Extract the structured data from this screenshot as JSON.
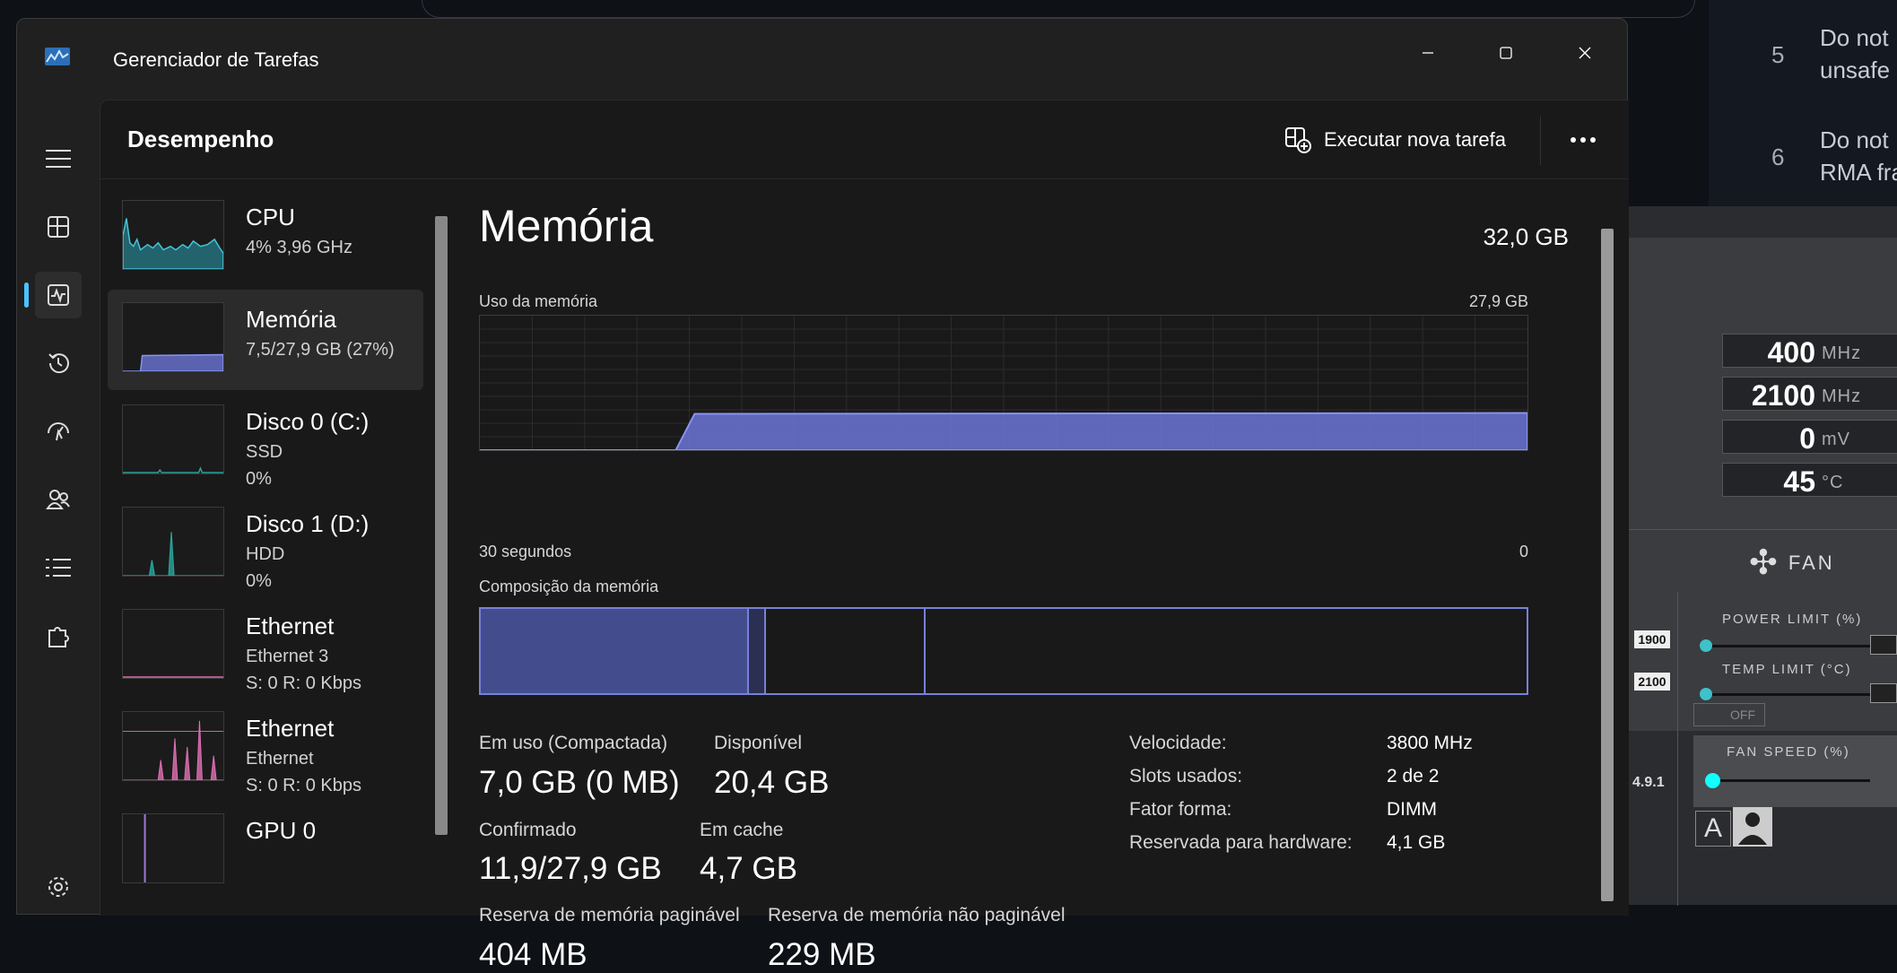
{
  "background_doc": {
    "items": [
      {
        "num": "5",
        "line1": "Do not",
        "line2": "unsafe"
      },
      {
        "num": "6",
        "line1": "Do not",
        "line2": "RMA fra"
      }
    ]
  },
  "oc_app": {
    "readouts": [
      {
        "value": "400",
        "unit": "MHz"
      },
      {
        "value": "2100",
        "unit": "MHz"
      },
      {
        "value": "0",
        "unit": "mV"
      },
      {
        "value": "45",
        "unit": "°C"
      }
    ],
    "fan_label": "FAN",
    "power_limit": "POWER LIMIT (%)",
    "temp_limit": "TEMP LIMIT (°C)",
    "fan_speed": "FAN SPEED (%)",
    "left_values": [
      "1900",
      "2100"
    ],
    "off_label": "OFF",
    "version": "4.9.1",
    "a_button": "A"
  },
  "window": {
    "title": "Gerenciador de Tarefas"
  },
  "header": {
    "title": "Desempenho",
    "run_task_label": "Executar nova tarefa"
  },
  "perf_items": [
    {
      "name": "CPU",
      "sub": "4%  3,96 GHz",
      "sub2": ""
    },
    {
      "name": "Memória",
      "sub": "7,5/27,9 GB (27%)",
      "sub2": ""
    },
    {
      "name": "Disco 0 (C:)",
      "sub": "SSD",
      "sub2": "0%"
    },
    {
      "name": "Disco 1 (D:)",
      "sub": "HDD",
      "sub2": "0%"
    },
    {
      "name": "Ethernet",
      "sub": "Ethernet 3",
      "sub2": "S: 0  R: 0 Kbps"
    },
    {
      "name": "Ethernet",
      "sub": "Ethernet",
      "sub2": "S: 0  R: 0 Kbps"
    },
    {
      "name": "GPU 0",
      "sub": "",
      "sub2": ""
    }
  ],
  "memory": {
    "title": "Memória",
    "total": "32,0 GB",
    "usage_label": "Uso da memória",
    "usage_max": "27,9 GB",
    "graph_left": "30 segundos",
    "graph_right": "0",
    "composition_label": "Composição da memória",
    "in_use_label": "Em uso (Compactada)",
    "in_use_value": "7,0 GB (0 MB)",
    "available_label": "Disponível",
    "available_value": "20,4 GB",
    "committed_label": "Confirmado",
    "committed_value": "11,9/27,9 GB",
    "cached_label": "Em cache",
    "cached_value": "4,7 GB",
    "paged_label": "Reserva de memória paginável",
    "paged_value": "404 MB",
    "nonpaged_label": "Reserva de memória não paginável",
    "nonpaged_value": "229 MB",
    "specs": [
      {
        "label": "Velocidade:",
        "value": "3800 MHz"
      },
      {
        "label": "Slots usados:",
        "value": "2 de 2"
      },
      {
        "label": "Fator forma:",
        "value": "DIMM"
      },
      {
        "label": "Reservada para hardware:",
        "value": "4,1 GB"
      }
    ],
    "usage_fraction": 0.27
  },
  "colors": {
    "memory_fill": "#6b75d6",
    "cpu_fill": "#2a9fb1",
    "disk_fill": "#2ba59a",
    "ethernet_fill": "#e070b5"
  }
}
